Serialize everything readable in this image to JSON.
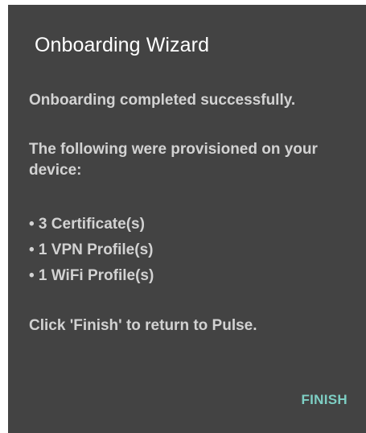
{
  "dialog": {
    "title": "Onboarding Wizard",
    "success_message": "Onboarding completed successfully.",
    "provisioned_intro": "The following were provisioned on your device:",
    "provisioned_items": [
      "• 3 Certificate(s)",
      "• 1 VPN Profile(s)",
      "• 1 WiFi Profile(s)"
    ],
    "instruction": "Click 'Finish' to return to Pulse.",
    "finish_label": "FINISH"
  },
  "colors": {
    "dialog_background": "#434343",
    "title_text": "#ffffff",
    "body_text": "#d2d2d2",
    "accent": "#7ecfc4"
  }
}
